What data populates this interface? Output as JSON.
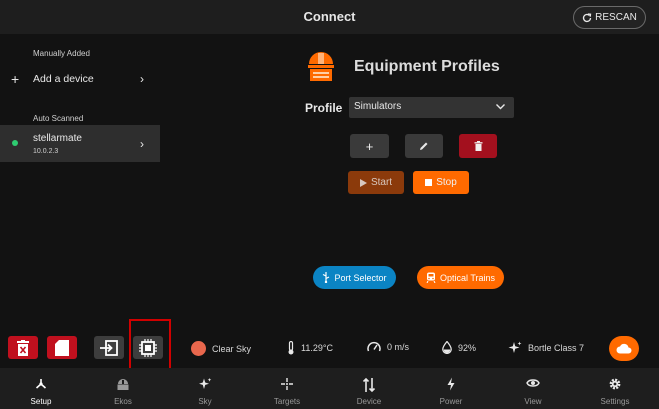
{
  "header": {
    "title": "Connect",
    "rescan_label": "RESCAN"
  },
  "sidebar": {
    "manual_label": "Manually Added",
    "add_device_label": "Add a device",
    "auto_label": "Auto Scanned",
    "device": {
      "name": "stellarmate",
      "ip": "10.0.2.3",
      "status_color": "#2ecc71"
    }
  },
  "equipment": {
    "title": "Equipment Profiles",
    "profile_label": "Profile",
    "profile_selected": "Simulators",
    "start_label": "Start",
    "stop_label": "Stop",
    "port_selector_label": "Port Selector",
    "optical_trains_label": "Optical Trains"
  },
  "status_bar": {
    "sky": "Clear Sky",
    "temperature": "11.29°C",
    "wind": "0 m/s",
    "humidity": "92%",
    "bortle": "Bortle Class 7"
  },
  "nav": [
    {
      "label": "Setup",
      "icon": "setup-icon",
      "active": true
    },
    {
      "label": "Ekos",
      "icon": "ekos-icon",
      "active": false
    },
    {
      "label": "Sky",
      "icon": "sparkle-icon",
      "active": false
    },
    {
      "label": "Targets",
      "icon": "crosshair-icon",
      "active": false
    },
    {
      "label": "Device",
      "icon": "device-arrows-icon",
      "active": false
    },
    {
      "label": "Power",
      "icon": "bolt-icon",
      "active": false
    },
    {
      "label": "View",
      "icon": "eye-icon",
      "active": false
    },
    {
      "label": "Settings",
      "icon": "gear-icon",
      "active": false
    }
  ],
  "colors": {
    "accent": "#ff6a00",
    "danger": "#c0101e",
    "info": "#0b84c4",
    "background": "#121212"
  }
}
